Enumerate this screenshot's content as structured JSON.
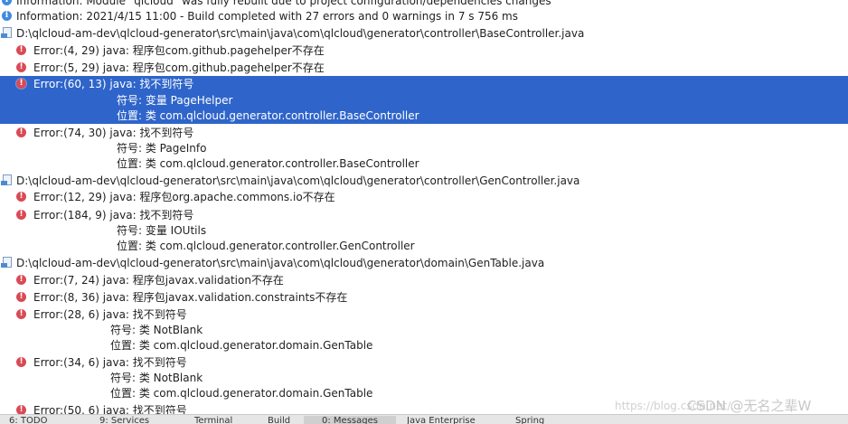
{
  "messages": {
    "info_top": "Information: Module \"qlcloud\" was fully rebuilt due to project configuration/dependencies changes",
    "info_build": "Information: 2021/4/15 11:00 - Build completed with 27 errors and 0 warnings in 7 s 756 ms"
  },
  "files": [
    {
      "path": "D:\\qlcloud-am-dev\\qlcloud-generator\\src\\main\\java\\com\\qlcloud\\generator\\controller\\BaseController.java",
      "errors": [
        {
          "text": "Error:(4, 29)  java: 程序包com.github.pagehelper不存在"
        },
        {
          "text": "Error:(5, 29)  java: 程序包com.github.pagehelper不存在"
        },
        {
          "text": "Error:(60, 13)  java: 找不到符号",
          "symbol": "符号:   变量 PageHelper",
          "location": "位置: 类 com.qlcloud.generator.controller.BaseController"
        },
        {
          "text": "Error:(74, 30)  java: 找不到符号",
          "symbol": "符号:   类 PageInfo",
          "location": "位置: 类 com.qlcloud.generator.controller.BaseController"
        }
      ]
    },
    {
      "path": "D:\\qlcloud-am-dev\\qlcloud-generator\\src\\main\\java\\com\\qlcloud\\generator\\controller\\GenController.java",
      "errors": [
        {
          "text": "Error:(12, 29)  java: 程序包org.apache.commons.io不存在"
        },
        {
          "text": "Error:(184, 9)  java: 找不到符号",
          "symbol": "符号:   变量 IOUtils",
          "location": "位置: 类 com.qlcloud.generator.controller.GenController"
        }
      ]
    },
    {
      "path": "D:\\qlcloud-am-dev\\qlcloud-generator\\src\\main\\java\\com\\qlcloud\\generator\\domain\\GenTable.java",
      "errors": [
        {
          "text": "Error:(7, 24)  java: 程序包javax.validation不存在"
        },
        {
          "text": "Error:(8, 36)  java: 程序包javax.validation.constraints不存在"
        },
        {
          "text": "Error:(28, 6)  java: 找不到符号",
          "symbol": "符号:   类 NotBlank",
          "location": "位置: 类 com.qlcloud.generator.domain.GenTable"
        },
        {
          "text": "Error:(34, 6)  java: 找不到符号",
          "symbol": "符号:   类 NotBlank",
          "location": "位置: 类 com.qlcloud.generator.domain.GenTable"
        },
        {
          "text": "Error:(50, 6)  java: 找不到符号"
        }
      ]
    }
  ],
  "bottom_tabs": [
    "6: TODO",
    "9: Services",
    "Terminal",
    "Build",
    "0: Messages",
    "Java Enterprise",
    "Spring"
  ],
  "watermark": {
    "url": "https://blog.csdn.net/...",
    "text": "CSDN @无名之辈W"
  },
  "colors": {
    "selection": "#2f65ca",
    "error_icon": "#d94a55",
    "info_icon": "#3f8be0"
  }
}
